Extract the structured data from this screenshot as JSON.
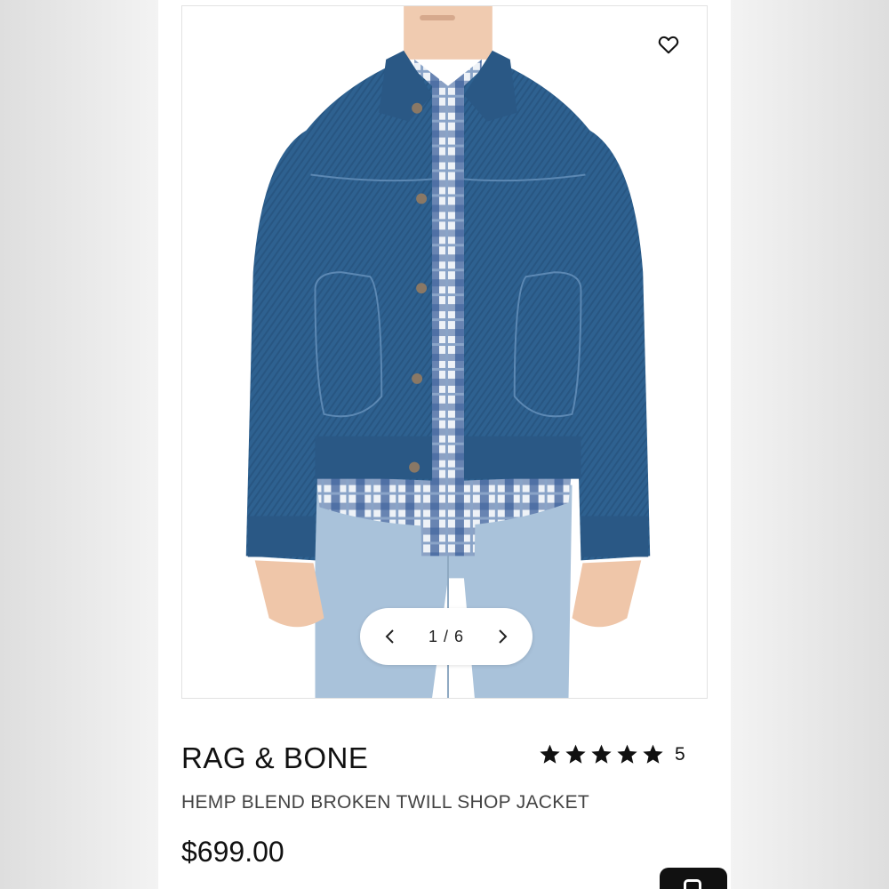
{
  "product": {
    "image_description": "Model wearing a blue denim jacket over a plaid shirt and light blue jeans",
    "wishlist_icon": "heart-outline-icon",
    "pager": {
      "current": "1",
      "total": "6",
      "label": "1 / 6",
      "prev_icon": "chevron-left-icon",
      "next_icon": "chevron-right-icon"
    },
    "brand": "RAG & BONE",
    "title": "HEMP BLEND BROKEN TWILL SHOP JACKET",
    "price": "$699.00",
    "rating": {
      "stars": 5,
      "max_stars": 5,
      "count": "5"
    }
  },
  "colors": {
    "jacket": "#2d5f8c",
    "jeans": "#a9c2da",
    "text": "#111111",
    "subtext": "#444444"
  }
}
